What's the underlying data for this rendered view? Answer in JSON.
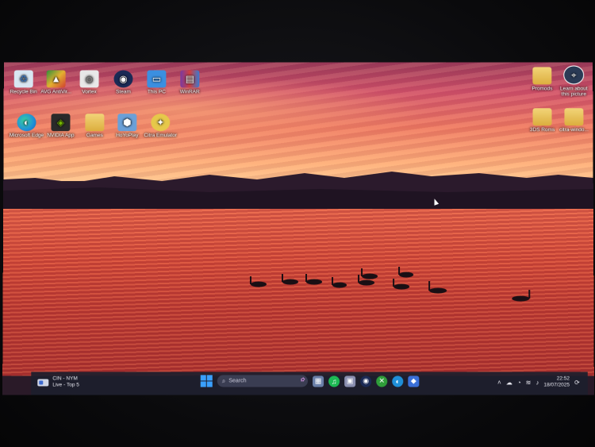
{
  "desktop": {
    "left_icons": [
      {
        "label": "Recycle Bin",
        "icon": "recycle-bin-icon",
        "color": "#d8e6f2"
      },
      {
        "label": "AVG AntiVir...",
        "icon": "avg-antivirus-icon",
        "color": "#3c6e3f"
      },
      {
        "label": "Vortex",
        "icon": "vortex-icon",
        "color": "#cfcfcf"
      },
      {
        "label": "Steam",
        "icon": "steam-icon",
        "color": "#1b2a55"
      },
      {
        "label": "This PC",
        "icon": "monitor-icon",
        "color": "#3b8fe0"
      },
      {
        "label": "WinRAR",
        "icon": "winrar-icon",
        "color": "#7a3aa0"
      },
      {
        "label": "Microsoft Edge",
        "icon": "edge-icon",
        "color": "#1f8fd8"
      },
      {
        "label": "NVIDIA App",
        "icon": "nvidia-icon",
        "color": "#2a2a2a"
      },
      {
        "label": "Games",
        "icon": "folder-icon",
        "color": "#e8c25a"
      },
      {
        "label": "HoYoPlay",
        "icon": "hoyoplay-icon",
        "color": "#6aa0d8"
      },
      {
        "label": "Citra Emulator",
        "icon": "citra-icon",
        "color": "#e6c84a"
      }
    ],
    "right_icons": [
      {
        "label": "Promods",
        "icon": "folder-icon",
        "color": "#e8c25a"
      },
      {
        "label": "Learn about this picture",
        "icon": "learn-about-picture-icon",
        "color": "#2a3a55"
      },
      {
        "label": "3DS Roms",
        "icon": "folder-icon",
        "color": "#e8c25a"
      },
      {
        "label": "citra-windo...",
        "icon": "folder-icon",
        "color": "#e8c25a"
      }
    ]
  },
  "taskbar": {
    "weather": {
      "line1": "CIN - NYM",
      "line2": "Live - Top 5"
    },
    "search_placeholder": "Search",
    "apps": [
      {
        "name": "taskbar-app-files",
        "icon": "file-explorer-icon",
        "color": "#6a7fa8",
        "glyph": "▦"
      },
      {
        "name": "taskbar-app-spotify",
        "icon": "spotify-icon",
        "color": "#1db954",
        "glyph": "♫"
      },
      {
        "name": "taskbar-app-photos",
        "icon": "photos-icon",
        "color": "#8a8fb0",
        "glyph": "▣"
      },
      {
        "name": "taskbar-app-steam",
        "icon": "steam-icon",
        "color": "#1b2a55",
        "glyph": "◉"
      },
      {
        "name": "taskbar-app-xbox",
        "icon": "xbox-icon",
        "color": "#2f9e3a",
        "glyph": "✕"
      },
      {
        "name": "taskbar-app-edge",
        "icon": "edge-icon",
        "color": "#1f8fd8",
        "glyph": "◐"
      },
      {
        "name": "taskbar-app-store",
        "icon": "store-icon",
        "color": "#3a6fd8",
        "glyph": "◆"
      }
    ],
    "time": "22:52",
    "date": "18/07/2025"
  }
}
